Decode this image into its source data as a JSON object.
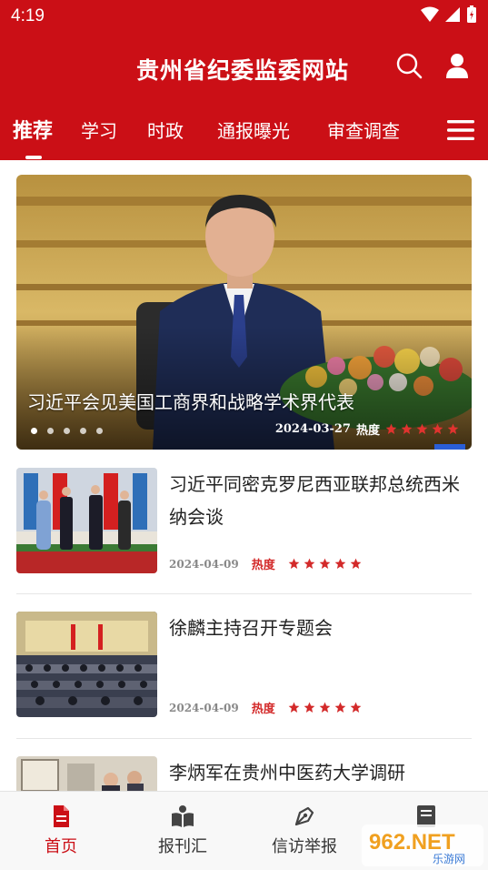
{
  "status_bar": {
    "time": "4:19"
  },
  "header": {
    "site_title": "贵州省纪委监委网站",
    "search_icon": "search-icon",
    "user_icon": "user-icon"
  },
  "tabs": [
    {
      "label": "推荐",
      "active": true
    },
    {
      "label": "学习",
      "active": false
    },
    {
      "label": "时政",
      "active": false
    },
    {
      "label": "通报曝光",
      "active": false
    },
    {
      "label": "审查调查",
      "active": false
    }
  ],
  "banner": {
    "title": "习近平会见美国工商界和战略学术界代表",
    "date": "2024-03-27",
    "heat_label": "热度",
    "heat_stars": 5,
    "slide_count": 5,
    "current_slide": 1
  },
  "news": [
    {
      "title": "习近平同密克罗尼西亚联邦总统西米纳会谈",
      "date": "2024-04-09",
      "heat_label": "热度",
      "heat_stars": 5
    },
    {
      "title": "徐麟主持召开专题会",
      "date": "2024-04-09",
      "heat_label": "热度",
      "heat_stars": 5
    },
    {
      "title": "李炳军在贵州中医药大学调研",
      "date": "",
      "heat_label": "",
      "heat_stars": 0
    }
  ],
  "bottom_nav": [
    {
      "label": "首页",
      "icon": "document-icon",
      "active": true
    },
    {
      "label": "报刊汇",
      "icon": "book-icon",
      "active": false
    },
    {
      "label": "信访举报",
      "icon": "pen-icon",
      "active": false
    },
    {
      "label": "",
      "icon": "list-icon",
      "active": false
    }
  ],
  "watermark": {
    "text": "962.NET",
    "sub": "乐游网"
  },
  "colors": {
    "brand_red": "#cb0f16",
    "heat_red": "#d32a2a"
  }
}
